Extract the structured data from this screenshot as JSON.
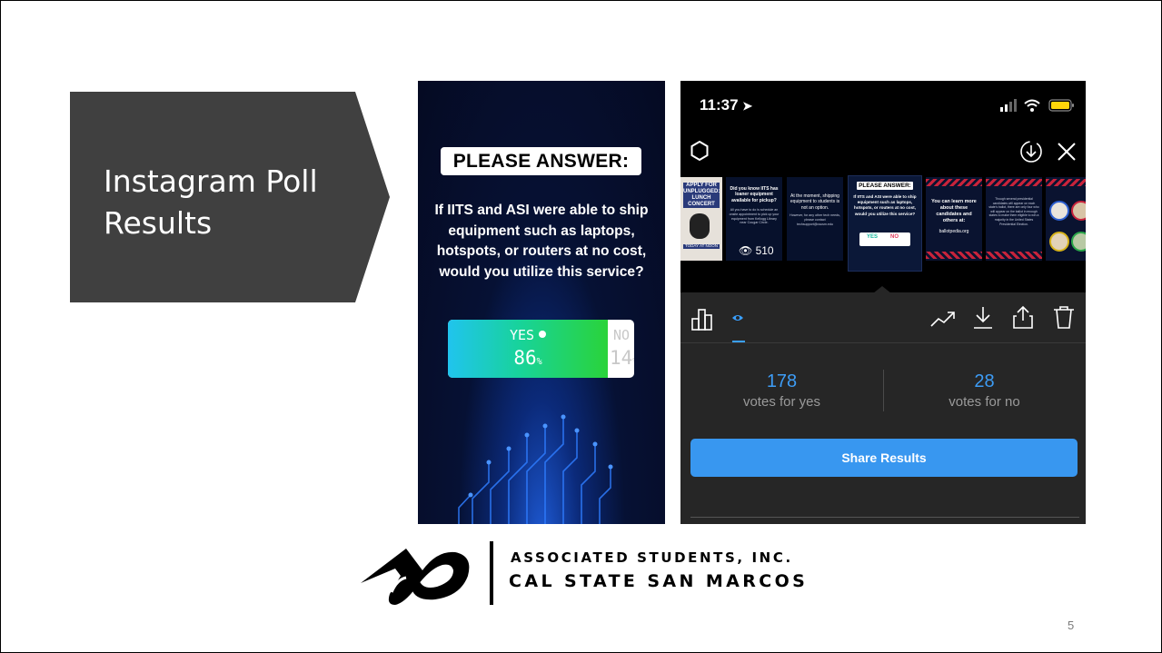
{
  "slide": {
    "title_line1": "Instagram Poll",
    "title_line2": "Results",
    "page_number": "5"
  },
  "story": {
    "heading": "PLEASE ANSWER:",
    "question": "If IITS and ASI were able to ship equipment such as laptops, hotspots, or routers at no cost, would you utilize this service?",
    "yes_label": "YES",
    "yes_percent": "86",
    "no_label": "NO",
    "no_percent": "14",
    "percent_sign": "%"
  },
  "phone": {
    "status_time": "11:37",
    "thumbnails": [
      {
        "title": "APPLY FOR UNPLUGGED: LUNCH CONCERT",
        "sub": "TODAY AT NOON"
      },
      {
        "title": "Did you know IITS has loaner equipment available for pickup?",
        "sub": "All you have to do is schedule an onsite appointment to pick up your equipment from Kellogg Library near Cougar Circle.",
        "views": "510"
      },
      {
        "title": "At the moment, shipping equipment to students is not an option.",
        "sub": "However, for any other tech needs, please contact techsupport@csusm.edu"
      },
      {
        "title": "You can learn more about these candidates and others at:",
        "sub": "ballotpedia.org"
      },
      {
        "title": "",
        "sub": "Though several presidential candidates will appear on each state's ballot, there are only four who will appear on the ballot in enough states to make them eligible to win a majority in the United States Presidential Election."
      }
    ],
    "active_thumb": {
      "heading": "PLEASE ANSWER:",
      "question": "If IITS and ASI were able to ship equipment such as laptops, hotspots, or routers at no cost, would you utilize this service?",
      "yes": "YES",
      "no": "NO"
    },
    "yes_votes": "178",
    "yes_votes_label": "votes for yes",
    "no_votes": "28",
    "no_votes_label": "votes for no",
    "share_button": "Share Results",
    "colors": {
      "accent": "#3897f0",
      "count": "#3d9cf5",
      "panel": "#262626"
    }
  },
  "logo": {
    "line1": "ASSOCIATED STUDENTS, INC.",
    "line2": "CAL STATE SAN MARCOS"
  },
  "colors": {
    "title_shape": "#404040"
  }
}
